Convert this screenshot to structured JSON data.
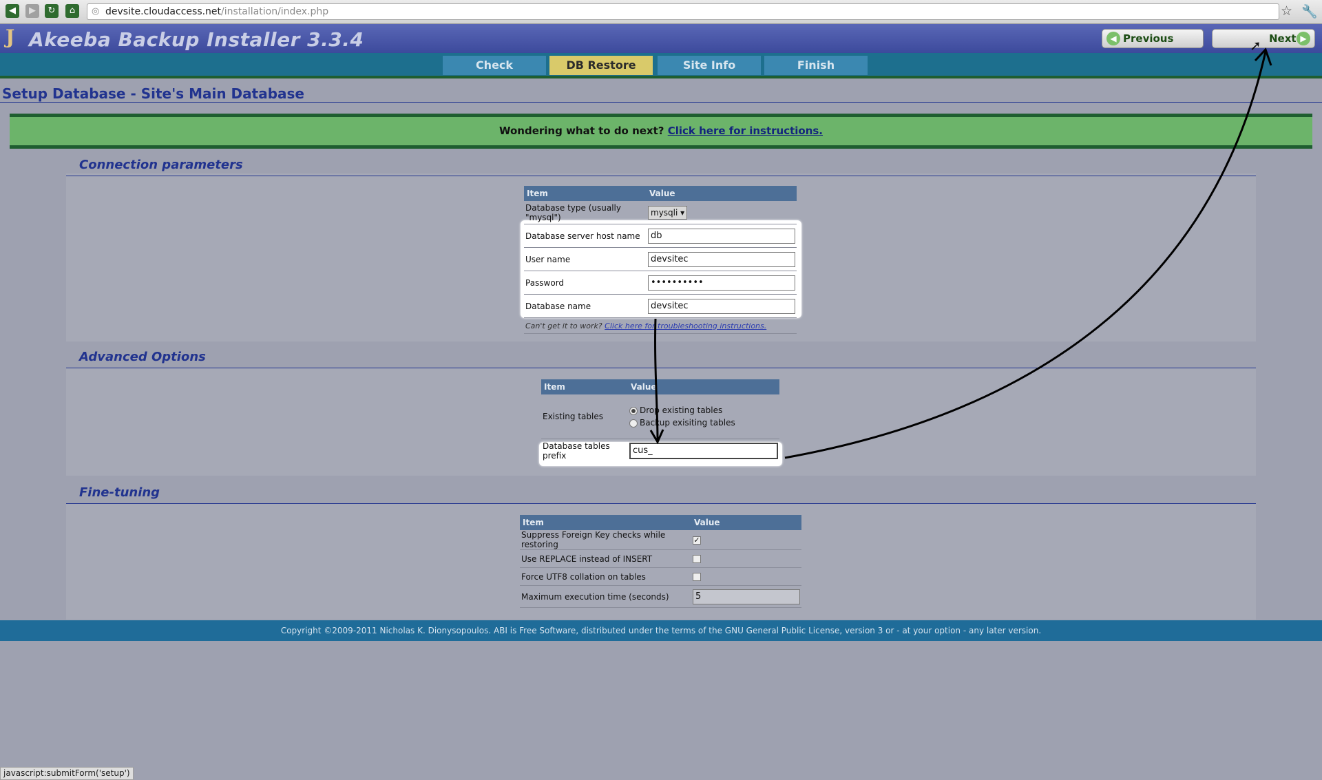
{
  "browser": {
    "url_domain": "devsite.cloudaccess.net",
    "url_path": "/installation/index.php"
  },
  "header": {
    "title": "Akeeba Backup Installer 3.3.4",
    "previous_label": "Previous",
    "next_label": "Next"
  },
  "steps": [
    {
      "label": "Check",
      "active": false
    },
    {
      "label": "DB Restore",
      "active": true
    },
    {
      "label": "Site Info",
      "active": false
    },
    {
      "label": "Finish",
      "active": false
    }
  ],
  "page": {
    "title": "Setup Database - Site's Main Database",
    "banner_text": "Wondering what to do next?",
    "banner_link": "Click here for instructions."
  },
  "connection": {
    "heading": "Connection parameters",
    "col_item": "Item",
    "col_value": "Value",
    "db_type_label": "Database type (usually \"mysql\")",
    "db_type_value": "mysqli",
    "host_label": "Database server host name",
    "host_value": "db",
    "user_label": "User name",
    "user_value": "devsitec",
    "password_label": "Password",
    "password_value": "••••••••••",
    "dbname_label": "Database name",
    "dbname_value": "devsitec",
    "help_text": "Can't get it to work?",
    "help_link": "Click here for troubleshooting instructions."
  },
  "advanced": {
    "heading": "Advanced Options",
    "col_item": "Item",
    "col_value": "Value",
    "existing_label": "Existing tables",
    "option_drop": "Drop existing tables",
    "option_backup": "Backup exisiting tables",
    "prefix_label": "Database tables prefix",
    "prefix_value": "cus_"
  },
  "finetune": {
    "heading": "Fine-tuning",
    "col_item": "Item",
    "col_value": "Value",
    "fk_label": "Suppress Foreign Key checks while restoring",
    "fk_checked": true,
    "replace_label": "Use REPLACE instead of INSERT",
    "replace_checked": false,
    "utf8_label": "Force UTF8 collation on tables",
    "utf8_checked": false,
    "maxexec_label": "Maximum execution time (seconds)",
    "maxexec_value": "5"
  },
  "footer": {
    "copyright": "Copyright ©2009-2011 Nicholas K. Dionysopoulos. ABI is Free Software, distributed under the terms of the GNU General Public License, version 3 or - at your option - any later version."
  },
  "status_bar": "javascript:submitForm('setup')"
}
